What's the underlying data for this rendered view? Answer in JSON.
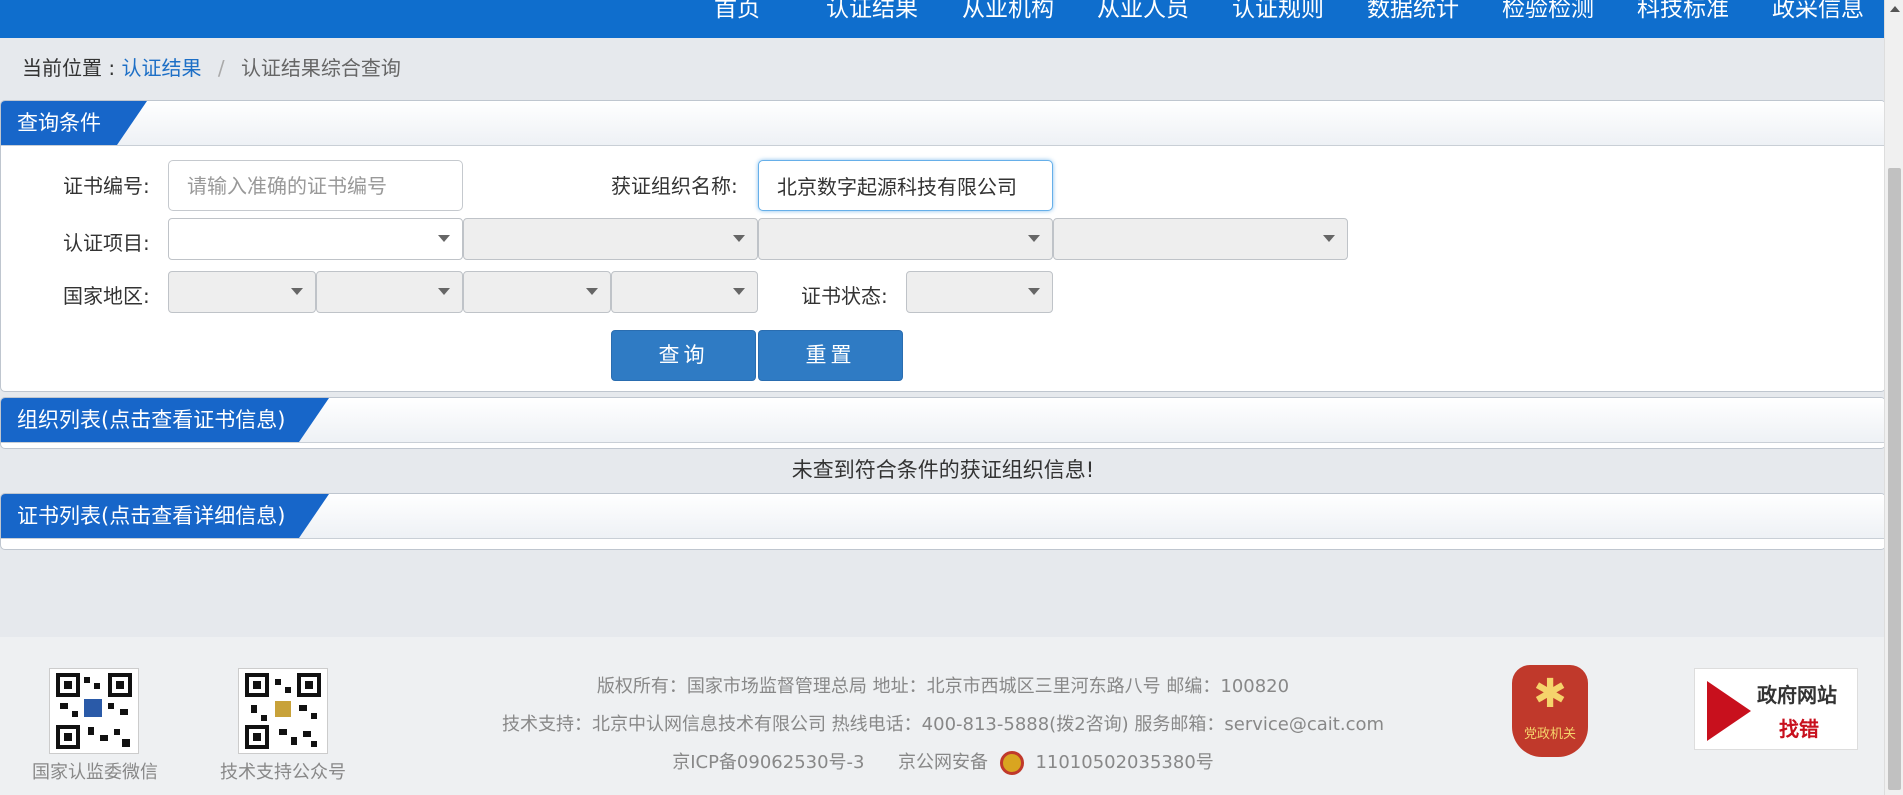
{
  "nav": {
    "items": [
      "首页",
      "认证结果",
      "从业机构",
      "从业人员",
      "认证规则",
      "数据统计",
      "检验检测",
      "科技标准",
      "政采信息"
    ]
  },
  "breadcrumb": {
    "prefix": "当前位置 :",
    "link": "认证结果",
    "separator": "/",
    "current": "认证结果综合查询"
  },
  "query_panel": {
    "title": "查询条件",
    "cert_no_label": "证书编号:",
    "cert_no_placeholder": "请输入准确的证书编号",
    "cert_no_value": "",
    "org_name_label": "获证组织名称:",
    "org_name_value": "北京数字起源科技有限公司",
    "project_label": "认证项目:",
    "region_label": "国家地区:",
    "status_label": "证书状态:",
    "search_button": "查询",
    "reset_button": "重置"
  },
  "org_panel": {
    "title": "组织列表(点击查看证书信息)",
    "empty_message": "未查到符合条件的获证组织信息!"
  },
  "cert_panel": {
    "title": "证书列表(点击查看详细信息)"
  },
  "footer": {
    "line1": "版权所有：国家市场监督管理总局    地址：北京市西城区三里河东路八号    邮编：100820",
    "line2": "技术支持：北京中认网信息技术有限公司    热线电话：400-813-5888(拨2咨询)    服务邮箱：service@cait.com",
    "line3_icp": "京ICP备09062530号-3",
    "line3_police_label": "京公网安备",
    "line3_police_no": "11010502035380号",
    "qr1_caption": "国家认监委微信",
    "qr2_caption": "技术支持公众号",
    "badge_text": "党政机关",
    "jiucuo_line1": "政府网站",
    "jiucuo_line2": "找错"
  },
  "colors": {
    "nav_bg": "#0f6ecd",
    "tab_bg": "#1766c9",
    "button_bg": "#2f7bc4",
    "link": "#1d6fc6"
  }
}
